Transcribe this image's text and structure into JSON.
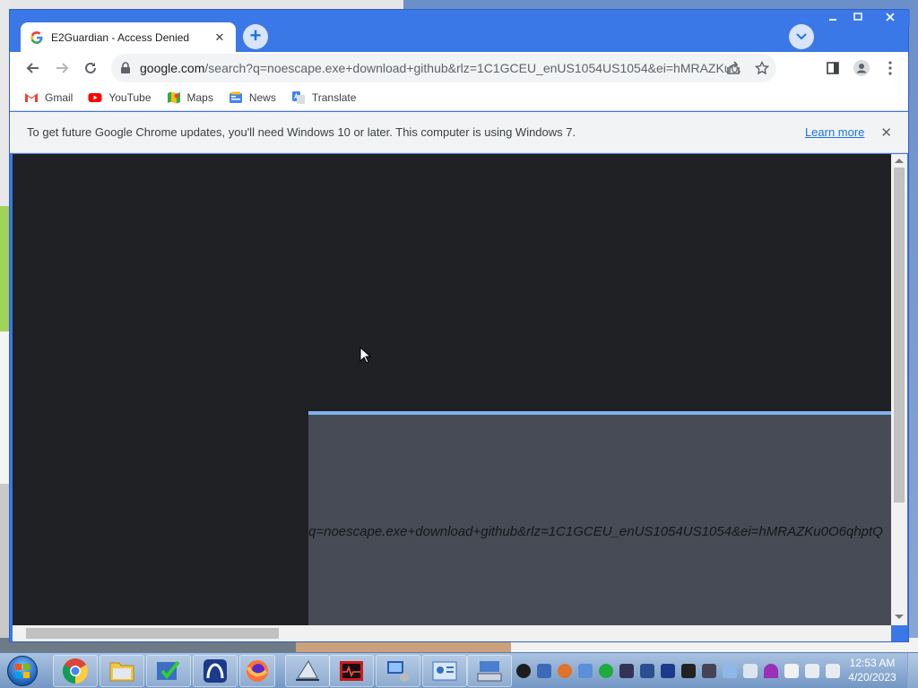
{
  "tab": {
    "title": "E2Guardian - Access Denied",
    "close": "✕"
  },
  "new_tab": "+",
  "address": {
    "url_host": "google.com",
    "url_rest": "/search?q=noescape.exe+download+github&rlz=1C1GCEU_enUS1054US1054&ei=hMRAZKu0..."
  },
  "bookmarks": [
    {
      "label": "Gmail",
      "icon": "gmail-icon"
    },
    {
      "label": "YouTube",
      "icon": "youtube-icon"
    },
    {
      "label": "Maps",
      "icon": "maps-icon"
    },
    {
      "label": "News",
      "icon": "news-icon"
    },
    {
      "label": "Translate",
      "icon": "translate-icon"
    }
  ],
  "infobar": {
    "message": "To get future Google Chrome updates, you'll need Windows 10 or later. This computer is using Windows 7.",
    "link": "Learn more",
    "close": "✕"
  },
  "page": {
    "panel_text": "q=noescape.exe+download+github&rlz=1C1GCEU_enUS1054US1054&ei=hMRAZKu0O6qhptQ"
  },
  "taskbar": {
    "time": "12:53 AM",
    "date": "4/20/2023"
  },
  "colors": {
    "chrome_blue": "#3b78e7",
    "page_dark": "#202124",
    "panel_gray": "#474b55",
    "panel_accent": "#7fb2ef",
    "infobar_bg": "#f1f3f4",
    "taskbar": "#7fa0c8"
  }
}
